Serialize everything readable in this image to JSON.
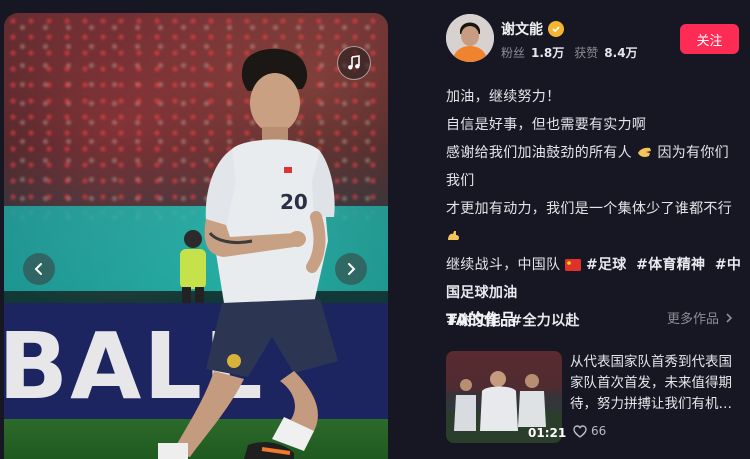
{
  "media": {
    "board_text": "BALL"
  },
  "author": {
    "name": "谢文能",
    "fans_label": "粉丝",
    "fans_value": "1.8万",
    "likes_label": "获赞",
    "likes_value": "8.4万",
    "follow_label": "关注"
  },
  "caption": {
    "line1": "加油，继续努力！",
    "line2": "自信是好事，但也需要有实力啊",
    "line3a": "感谢给我们加油鼓劲的所有人",
    "line3b": "因为有你们我们",
    "line4a": "才更加有动力，我们是一个集体少了谁都不行",
    "line5a": "继续战斗，中国队",
    "tags": [
      "#足球",
      "#体育精神",
      "#中国足球加油",
      "#谢文能",
      "#全力以赴"
    ]
  },
  "works": {
    "title": "TA的作品",
    "more_label": "更多作品",
    "items": [
      {
        "title": "从代表国家队首秀到代表国家队首次首发，未来值得期待，努力拼搏让我们有机…",
        "duration": "01:21",
        "likes": "66"
      }
    ]
  },
  "colors": {
    "background": "#161722",
    "follow_button": "#fe2c55",
    "verified_badge": "#f6b431",
    "muted_text": "#8b8b95"
  },
  "icons": {
    "music": "music-note-icon",
    "prev": "chevron-left-icon",
    "next": "chevron-right-icon",
    "verified": "verified-check-icon",
    "more": "chevron-right-icon",
    "like": "heart-outline-icon"
  }
}
